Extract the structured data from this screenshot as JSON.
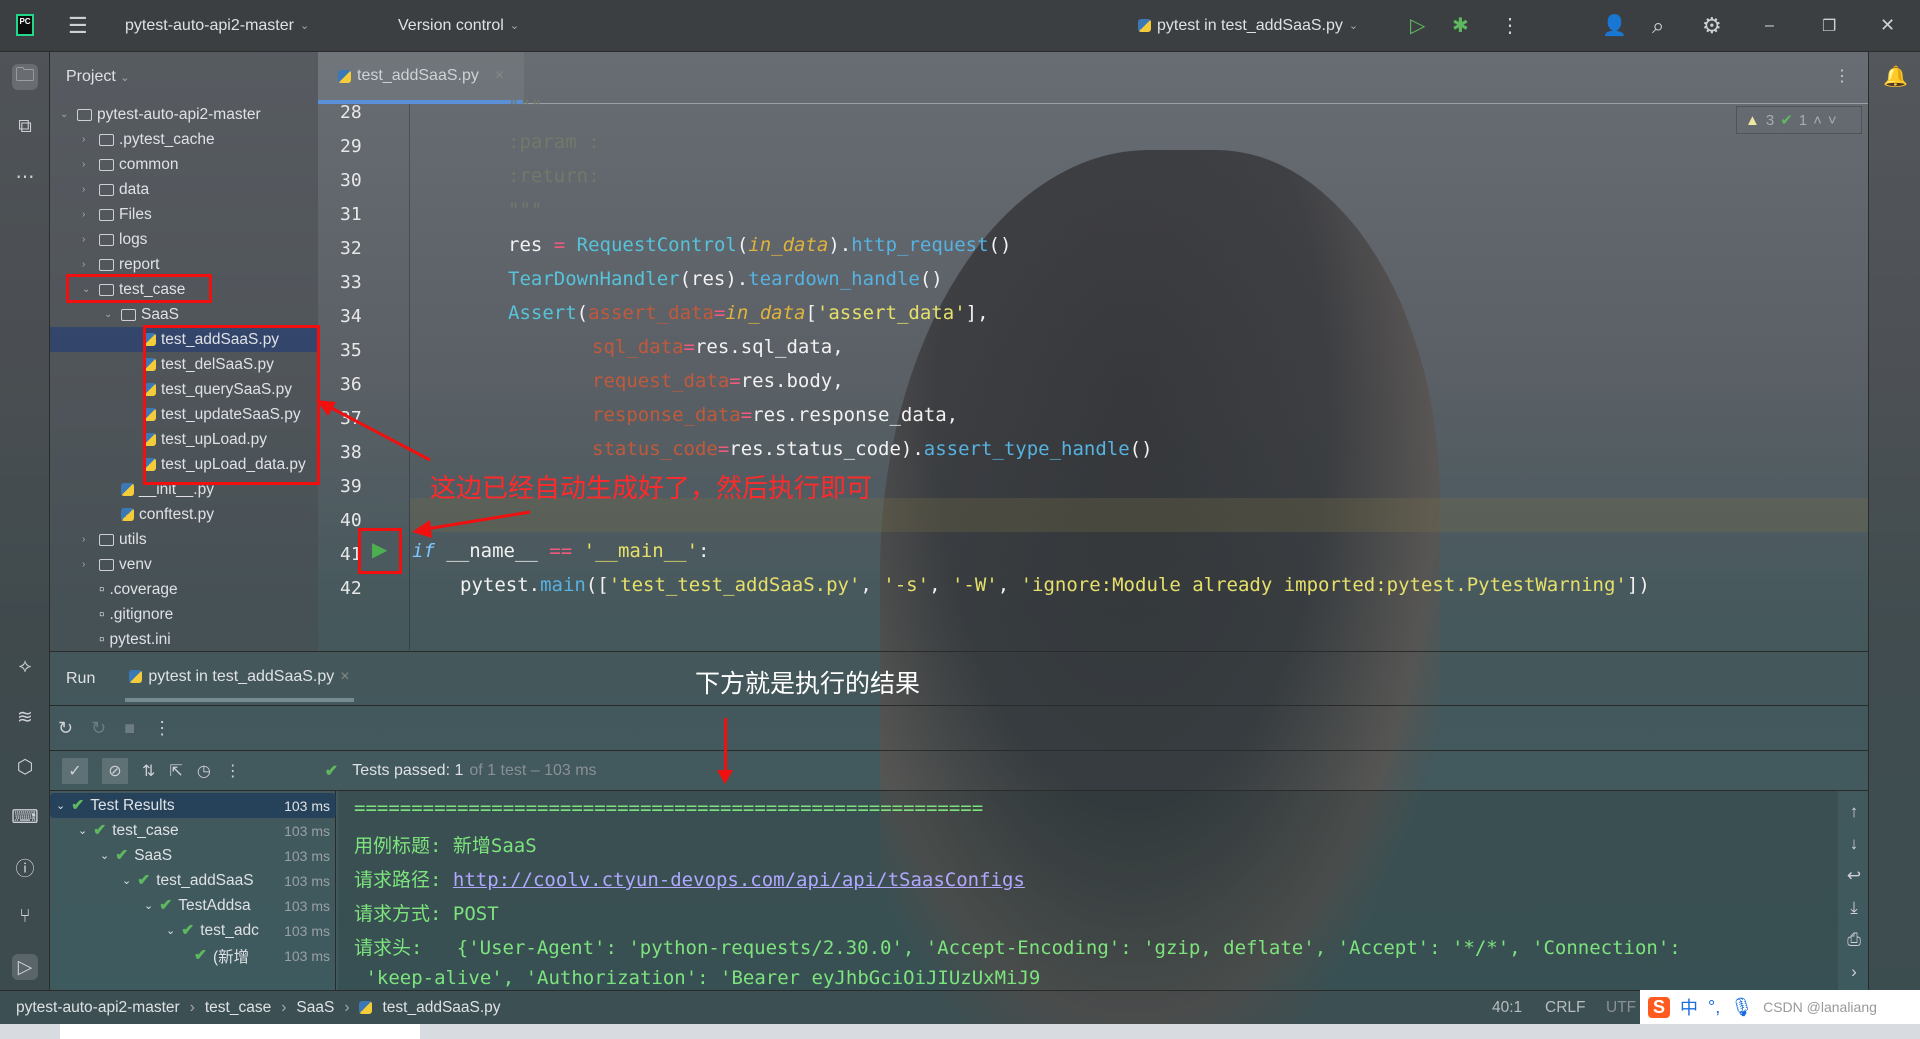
{
  "titlebar": {
    "project": "pytest-auto-api2-master",
    "vcs": "Version control",
    "run_config": "pytest in test_addSaaS.py",
    "logo": "PC"
  },
  "project_panel": {
    "title": "Project",
    "items": [
      {
        "label": "pytest-auto-api2-master",
        "type": "folder",
        "depth": 0,
        "expanded": true
      },
      {
        "label": ".pytest_cache",
        "type": "folder",
        "depth": 1
      },
      {
        "label": "common",
        "type": "folder",
        "depth": 1
      },
      {
        "label": "data",
        "type": "folder",
        "depth": 1
      },
      {
        "label": "Files",
        "type": "folder",
        "depth": 1
      },
      {
        "label": "logs",
        "type": "folder",
        "depth": 1
      },
      {
        "label": "report",
        "type": "folder",
        "depth": 1
      },
      {
        "label": "test_case",
        "type": "folder",
        "depth": 1,
        "expanded": true
      },
      {
        "label": "SaaS",
        "type": "folder",
        "depth": 2,
        "expanded": true
      },
      {
        "label": "test_addSaaS.py",
        "type": "py",
        "depth": 3,
        "selected": true
      },
      {
        "label": "test_delSaaS.py",
        "type": "py",
        "depth": 3
      },
      {
        "label": "test_querySaaS.py",
        "type": "py",
        "depth": 3
      },
      {
        "label": "test_updateSaaS.py",
        "type": "py",
        "depth": 3
      },
      {
        "label": "test_upLoad.py",
        "type": "py",
        "depth": 3
      },
      {
        "label": "test_upLoad_data.py",
        "type": "py",
        "depth": 3
      },
      {
        "label": "__init__.py",
        "type": "py",
        "depth": 2
      },
      {
        "label": "conftest.py",
        "type": "py",
        "depth": 2
      },
      {
        "label": "utils",
        "type": "folder",
        "depth": 1
      },
      {
        "label": "venv",
        "type": "folder",
        "depth": 1
      },
      {
        "label": ".coverage",
        "type": "file",
        "depth": 1
      },
      {
        "label": ".gitignore",
        "type": "file",
        "depth": 1
      },
      {
        "label": "pytest.ini",
        "type": "file",
        "depth": 1
      }
    ]
  },
  "editor": {
    "tab": "test_addSaaS.py",
    "inspections": {
      "warnings": "3",
      "ok": "1"
    },
    "line_numbers": [
      "28",
      "29",
      "30",
      "31",
      "32",
      "33",
      "34",
      "35",
      "36",
      "37",
      "38",
      "39",
      "40",
      "41",
      "42"
    ]
  },
  "annotations": {
    "auto_generated": "这边已经自动生成好了，然后执行即可",
    "result_below": "下方就是执行的结果"
  },
  "run": {
    "title": "Run",
    "tab": "pytest in test_addSaaS.py",
    "status": "Tests passed: 1",
    "status_detail": "of 1 test – 103 ms",
    "tree": [
      {
        "label": "Test Results",
        "time": "103 ms",
        "depth": 0
      },
      {
        "label": "test_case",
        "time": "103 ms",
        "depth": 1
      },
      {
        "label": "SaaS",
        "time": "103 ms",
        "depth": 2
      },
      {
        "label": "test_addSaaS",
        "time": "103 ms",
        "depth": 3
      },
      {
        "label": "TestAddsa",
        "time": "103 ms",
        "depth": 4
      },
      {
        "label": "test_adc",
        "time": "103 ms",
        "depth": 5
      },
      {
        "label": "(新增",
        "time": "103 ms",
        "depth": 6
      }
    ],
    "console": {
      "separator": "=======================================================",
      "title_label": "用例标题: ",
      "title_value": "新增SaaS",
      "path_label": "请求路径: ",
      "path_url": "http://coolv.ctyun-devops.com/api/api/tSaasConfigs",
      "method_label": "请求方式: ",
      "method_value": "POST",
      "headers_label": "请求头:   ",
      "headers_line1": "{'User-Agent': 'python-requests/2.30.0', 'Accept-Encoding': 'gzip, deflate', 'Accept': '*/*', 'Connection':",
      "headers_line2": " 'keep-alive', 'Authorization': 'Bearer eyJhbGciOiJIUzUxMiJ9"
    }
  },
  "statusbar": {
    "breadcrumb": [
      "pytest-auto-api2-master",
      "test_case",
      "SaaS",
      "test_addSaaS.py"
    ],
    "position": "40:1",
    "line_sep": "CRLF",
    "encoding": "UTF"
  },
  "ime": {
    "lang": "中",
    "watermark": "CSDN @lanaliang"
  },
  "colors": {
    "annotation_red": "#f01010",
    "pass_green": "#5fb85f",
    "console_green": "#7de37d"
  }
}
